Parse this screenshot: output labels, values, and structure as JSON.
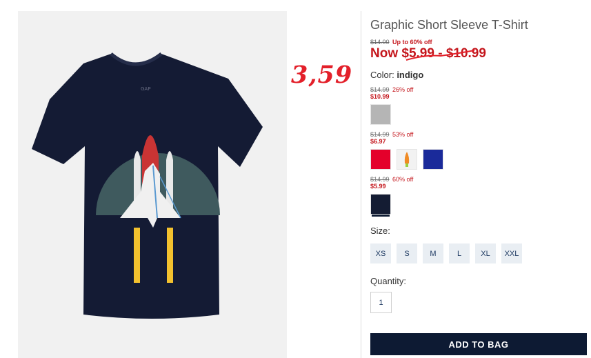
{
  "product": {
    "title": "Graphic Short Sleeve T-Shirt",
    "original_price": "$14.00",
    "discount_summary": "Up to 60% off",
    "now_price": "Now $5.99 - $10.99",
    "color_label": "Color:",
    "color_value": "indigo"
  },
  "annotation": {
    "handwritten_price": "3,59",
    "color": "#e3202a"
  },
  "price_groups": [
    {
      "was": "$14.99",
      "off": "26% off",
      "now": "$10.99",
      "swatches": [
        {
          "name": "heather-grey",
          "color": "#b5b5b5"
        }
      ]
    },
    {
      "was": "$14.99",
      "off": "53% off",
      "now": "$6.97",
      "swatches": [
        {
          "name": "red",
          "color": "#e4002b"
        },
        {
          "name": "rocket-print",
          "color": "#f2f2f2"
        },
        {
          "name": "royal-blue",
          "color": "#1a2a9a"
        }
      ]
    },
    {
      "was": "$14.99",
      "off": "60% off",
      "now": "$5.99",
      "swatches": [
        {
          "name": "indigo",
          "color": "#141c33",
          "selected": true
        }
      ]
    }
  ],
  "size": {
    "label": "Size:",
    "options": [
      "XS",
      "S",
      "M",
      "L",
      "XL",
      "XXL"
    ]
  },
  "quantity": {
    "label": "Quantity:",
    "value": "1"
  },
  "cta": {
    "label": "ADD TO BAG"
  },
  "colors": {
    "accent_red": "#c4161c",
    "navy": "#0d1a33",
    "shirt": "#141b34"
  }
}
